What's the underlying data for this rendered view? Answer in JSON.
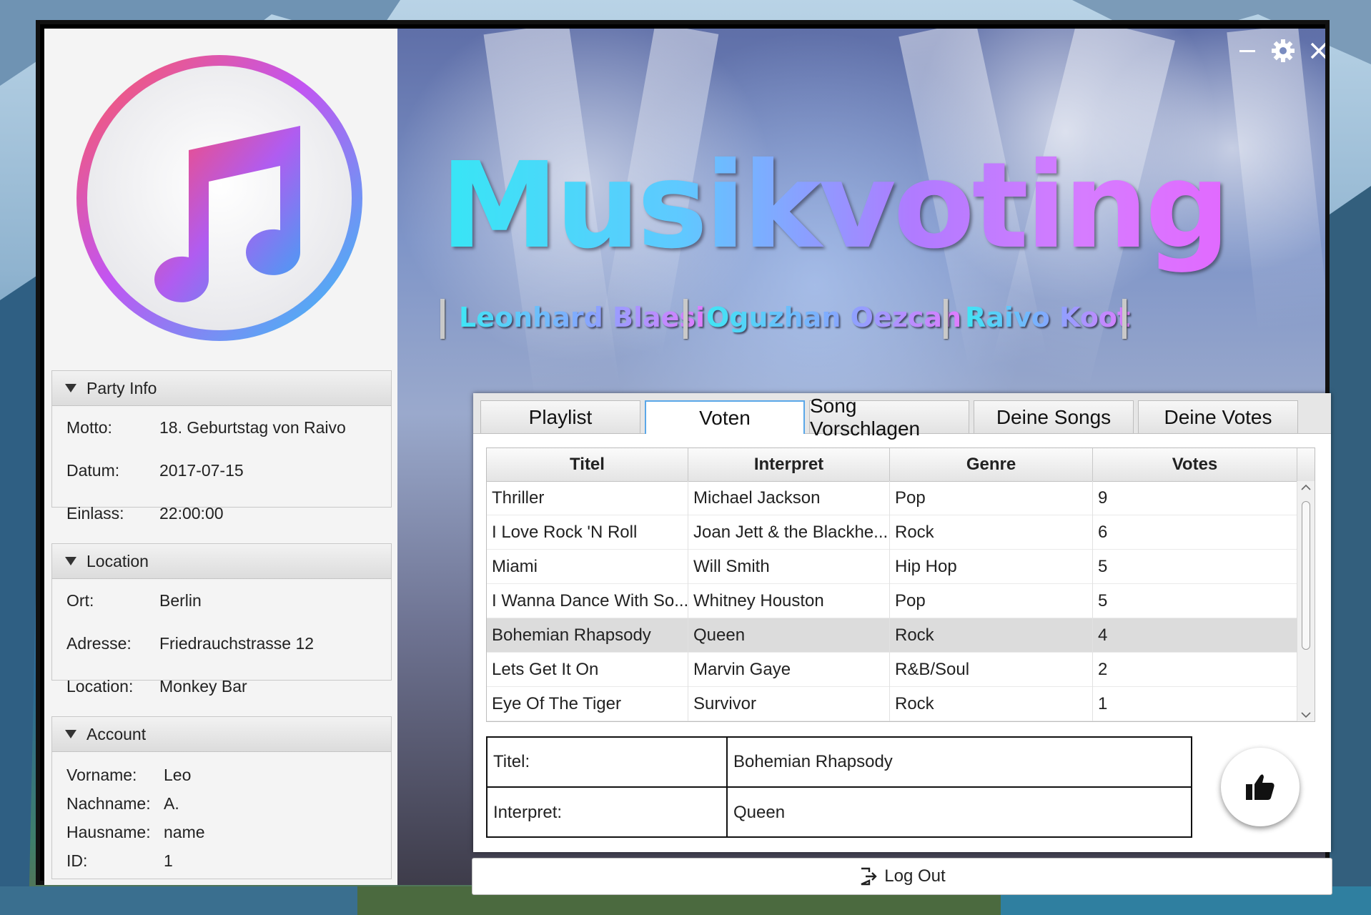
{
  "app": {
    "title": "Musikvoting",
    "authors": [
      "Leonhard Blaesi",
      "Oguzhan Oezcan",
      "Raivo Koot"
    ]
  },
  "window_controls": {
    "minimize": "minimize-icon",
    "settings": "gear-icon",
    "close": "close-icon"
  },
  "party_info": {
    "header": "Party Info",
    "rows": [
      {
        "label": "Motto:",
        "value": "18. Geburtstag von Raivo"
      },
      {
        "label": "Datum:",
        "value": "2017-07-15"
      },
      {
        "label": "Einlass:",
        "value": "22:00:00"
      }
    ]
  },
  "location": {
    "header": "Location",
    "rows": [
      {
        "label": "Ort:",
        "value": "Berlin"
      },
      {
        "label": "Adresse:",
        "value": "Friedrauchstrasse 12"
      },
      {
        "label": "Location:",
        "value": "Monkey Bar"
      }
    ]
  },
  "account": {
    "header": "Account",
    "rows": [
      {
        "label": "Vorname:",
        "value": "Leo"
      },
      {
        "label": "Nachname:",
        "value": "A."
      },
      {
        "label": "Hausname:",
        "value": "name"
      },
      {
        "label": "ID:",
        "value": "1"
      }
    ]
  },
  "tabs": [
    {
      "label": "Playlist",
      "active": false
    },
    {
      "label": "Voten",
      "active": true
    },
    {
      "label": "Song Vorschlagen",
      "active": false
    },
    {
      "label": "Deine Songs",
      "active": false
    },
    {
      "label": "Deine Votes",
      "active": false
    }
  ],
  "table": {
    "columns": [
      "Titel",
      "Interpret",
      "Genre",
      "Votes"
    ],
    "rows": [
      [
        "Thriller",
        "Michael Jackson",
        "Pop",
        "9"
      ],
      [
        "I Love Rock 'N Roll",
        "Joan Jett & the Blackhe...",
        "Rock",
        "6"
      ],
      [
        "Miami",
        "Will Smith",
        "Hip Hop",
        "5"
      ],
      [
        "I Wanna Dance With So...",
        "Whitney Houston",
        "Pop",
        "5"
      ],
      [
        "Bohemian Rhapsody",
        "Queen",
        "Rock",
        "4"
      ],
      [
        "Lets Get It On",
        "Marvin Gaye",
        "R&B/Soul",
        "2"
      ],
      [
        "Eye Of The Tiger",
        "Survivor",
        "Rock",
        "1"
      ]
    ],
    "selected_row": 4
  },
  "detail": {
    "title_label": "Titel:",
    "title_value": "Bohemian Rhapsody",
    "artist_label": "Interpret:",
    "artist_value": "Queen"
  },
  "vote_button": {
    "icon": "thumbs-up-icon"
  },
  "logout": {
    "label": "Log Out",
    "icon": "logout-icon"
  }
}
